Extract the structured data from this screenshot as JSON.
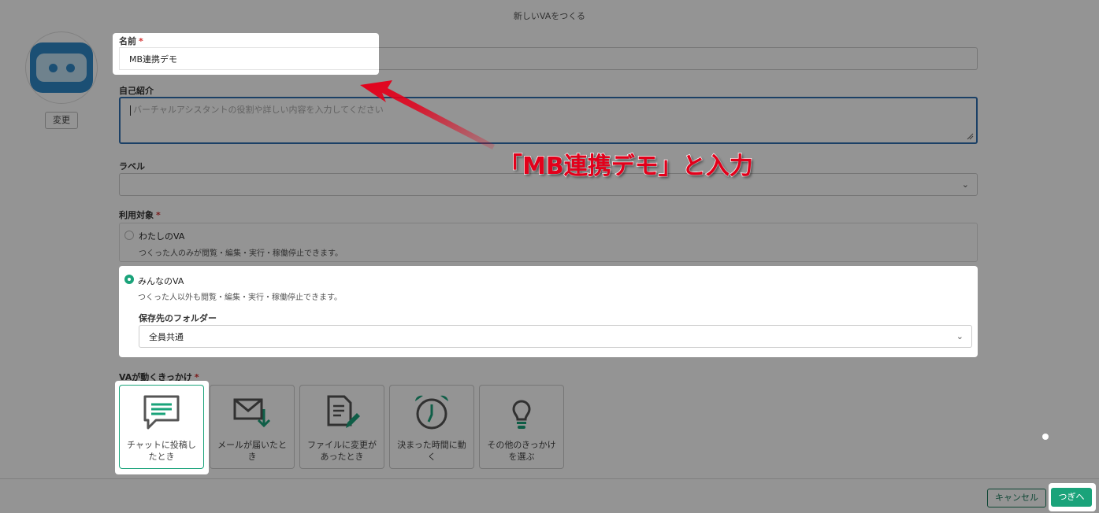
{
  "dialog": {
    "title": "新しいVAをつくる"
  },
  "avatar": {
    "change_label": "変更"
  },
  "name": {
    "label": "名前",
    "required": "*",
    "value": "MB連携デモ"
  },
  "intro": {
    "label": "自己紹介",
    "placeholder": "バーチャルアシスタントの役割や詳しい内容を入力してください"
  },
  "tag": {
    "label": "ラベル",
    "value": ""
  },
  "audience": {
    "label": "利用対象",
    "required": "*",
    "options": [
      {
        "title": "わたしのVA",
        "desc": "つくった人のみが閲覧・編集・実行・稼働停止できます。",
        "selected": false
      },
      {
        "title": "みんなのVA",
        "desc": "つくった人以外も閲覧・編集・実行・稼働停止できます。",
        "selected": true
      }
    ],
    "folder_label": "保存先のフォルダー",
    "folder_value": "全員共通"
  },
  "triggers": {
    "label": "VAが動くきっかけ",
    "required": "*",
    "items": [
      {
        "label": "チャットに投稿したとき",
        "icon": "chat-icon",
        "selected": true
      },
      {
        "label": "メールが届いたとき",
        "icon": "mail-download-icon",
        "selected": false
      },
      {
        "label": "ファイルに変更があったとき",
        "icon": "file-edit-icon",
        "selected": false
      },
      {
        "label": "決まった時間に動く",
        "icon": "alarm-clock-icon",
        "selected": false
      },
      {
        "label": "その他のきっかけを選ぶ",
        "icon": "lightbulb-icon",
        "selected": false
      }
    ]
  },
  "footer": {
    "cancel_label": "キャンセル",
    "next_label": "つぎへ"
  },
  "annotation": {
    "text": "「MB連携デモ」と入力",
    "color": "#e3001b"
  },
  "colors": {
    "accent": "#1aa37a",
    "focus_border": "#2f6fb0",
    "required": "#d32f2f"
  }
}
